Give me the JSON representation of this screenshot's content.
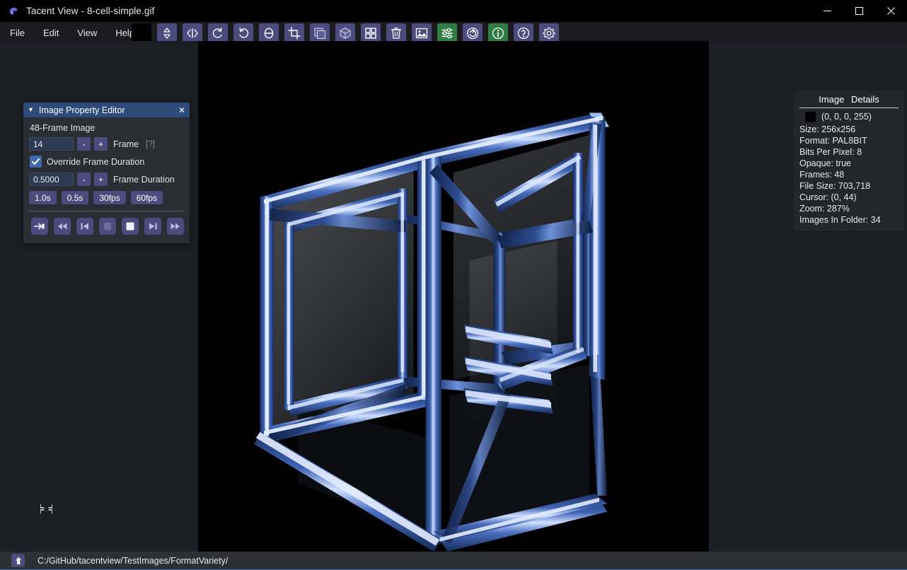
{
  "window": {
    "title": "Tacent View - 8-cell-simple.gif",
    "app_icon": "tacent-logo-icon",
    "controls": {
      "minimize": "—",
      "maximize": "☐",
      "close": "✕"
    }
  },
  "menubar": {
    "items": [
      {
        "label": "File",
        "name": "menu-file"
      },
      {
        "label": "Edit",
        "name": "menu-edit"
      },
      {
        "label": "View",
        "name": "menu-view"
      },
      {
        "label": "Help",
        "name": "menu-help"
      }
    ]
  },
  "toolbar": {
    "swatch_color": "#000000",
    "accent_purple": "#4b4c7d",
    "accent_green": "#2f7d45",
    "buttons": [
      {
        "name": "color-swatch",
        "icon": "color-swatch-icon",
        "tooltip": "Background Colour"
      },
      {
        "name": "flip-vertical-button",
        "icon": "flip-vertical-icon",
        "tooltip": "Flip Vertically"
      },
      {
        "name": "flip-horizontal-button",
        "icon": "flip-horizontal-icon",
        "tooltip": "Flip Horizontally"
      },
      {
        "name": "rotate-ccw-button",
        "icon": "rotate-counterclockwise-icon",
        "tooltip": "Rotate Anti-Clockwise"
      },
      {
        "name": "rotate-cw-button",
        "icon": "rotate-clockwise-icon",
        "tooltip": "Rotate Clockwise"
      },
      {
        "name": "rotate-arbitrary-button",
        "icon": "rotate-theta-icon",
        "tooltip": "Rotate Arbitrary"
      },
      {
        "name": "crop-button",
        "icon": "crop-icon",
        "tooltip": "Crop"
      },
      {
        "name": "resize-image-button",
        "icon": "stacked-squares-icon",
        "tooltip": "Resize Image"
      },
      {
        "name": "resize-canvas-button",
        "icon": "cube-icon",
        "tooltip": "Resize Canvas"
      },
      {
        "name": "contact-sheet-button",
        "icon": "grid-tiles-icon",
        "tooltip": "Contact Sheet"
      },
      {
        "name": "delete-button",
        "icon": "trash-icon",
        "tooltip": "Delete Image"
      },
      {
        "name": "image-properties-button",
        "icon": "picture-icon",
        "tooltip": "Image Properties"
      },
      {
        "name": "adjust-levels-button",
        "icon": "sliders-icon",
        "tooltip": "Levels"
      },
      {
        "name": "refresh-button",
        "icon": "refresh-circle-icon",
        "tooltip": "Refresh / Reload"
      },
      {
        "name": "info-button",
        "icon": "info-circle-icon",
        "tooltip": "Info Overlay"
      },
      {
        "name": "help-button",
        "icon": "question-circle-icon",
        "tooltip": "Help"
      },
      {
        "name": "settings-button",
        "icon": "gear-icon",
        "tooltip": "Settings"
      }
    ]
  },
  "image_property_editor": {
    "title": "Image Property Editor",
    "caret": "▼",
    "close": "✕",
    "heading": "48-Frame Image",
    "frame": {
      "value": "14",
      "minus": "-",
      "plus": "+",
      "label": "Frame",
      "help": "[?]"
    },
    "override": {
      "checked": true,
      "label": "Override Frame Duration"
    },
    "duration": {
      "value": "0.5000",
      "minus": "-",
      "plus": "+",
      "label": "Frame Duration"
    },
    "presets": [
      {
        "label": "1.0s",
        "name": "preset-1s-button"
      },
      {
        "label": "0.5s",
        "name": "preset-05s-button"
      },
      {
        "label": "30fps",
        "name": "preset-30fps-button"
      },
      {
        "label": "60fps",
        "name": "preset-60fps-button"
      }
    ],
    "playback": [
      {
        "name": "skip-to-end-button",
        "icon": "skip-to-end-icon"
      },
      {
        "name": "rewind-button",
        "icon": "rewind-icon"
      },
      {
        "name": "step-back-button",
        "icon": "step-back-icon"
      },
      {
        "name": "play-reverse-button",
        "icon": "stop-square-icon"
      },
      {
        "name": "play-button",
        "icon": "stop-square-light-icon"
      },
      {
        "name": "step-forward-button",
        "icon": "step-forward-icon"
      },
      {
        "name": "fast-forward-button",
        "icon": "fast-forward-icon"
      }
    ]
  },
  "details_panel": {
    "title_part1": "Image",
    "title_part2": "Details",
    "pixel_color_hex": "#000000",
    "pixel_value": "(0, 0, 0, 255)",
    "lines": [
      "Size: 256x256",
      "Format: PAL8BIT",
      "Bits Per Pixel: 8",
      "Opaque: true",
      "Frames: 48",
      "File Size: 703,718",
      "Cursor: (0, 44)",
      "Zoom: 287%",
      "Images In Folder: 34"
    ]
  },
  "canvas": {
    "background": "#000000",
    "content_description": "8-cell tesseract wireframe, blue metallic tubes on black",
    "cursor_icon": "crosshair-cursor-icon"
  },
  "statusbar": {
    "icon": "up-arrow-folder-icon",
    "path": "C:/GitHub/tacentview/TestImages/FormatVariety/"
  }
}
